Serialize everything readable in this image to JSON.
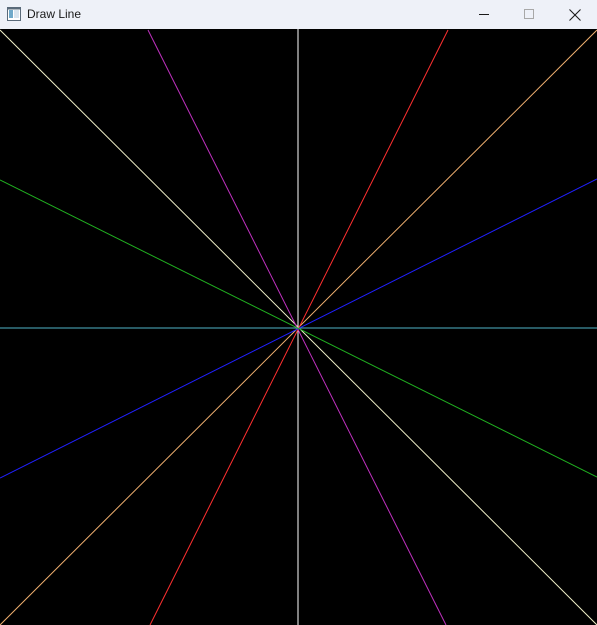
{
  "window": {
    "title": "Draw Line",
    "icons": {
      "app": "app-window-icon",
      "minimize": "minimize-icon",
      "maximize": "maximize-icon",
      "close": "close-icon"
    },
    "maximize_disabled": true
  },
  "canvas": {
    "background": "#000000",
    "lines": [
      {
        "name": "line-vertical-white",
        "color": "#ffffff"
      },
      {
        "name": "line-horizontal-cyan",
        "color": "#4fb3c8"
      },
      {
        "name": "line-diagonal-orange",
        "color": "#f0b070"
      },
      {
        "name": "line-diagonal-white",
        "color": "#f0f0c8"
      },
      {
        "name": "line-steep-red",
        "color": "#ff3030"
      },
      {
        "name": "line-steep-magenta",
        "color": "#c030c0"
      },
      {
        "name": "line-shallow-blue",
        "color": "#2020ff"
      },
      {
        "name": "line-shallow-green",
        "color": "#20b020"
      }
    ]
  }
}
